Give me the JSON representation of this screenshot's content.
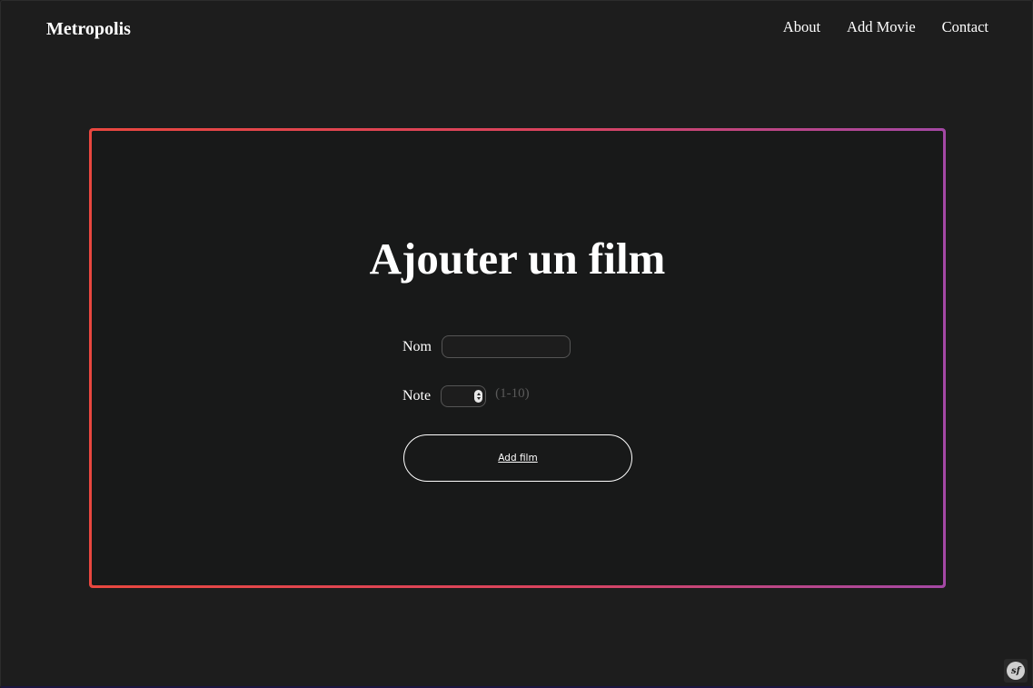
{
  "navbar": {
    "brand": "Metropolis",
    "links": [
      {
        "label": "About"
      },
      {
        "label": "Add Movie"
      },
      {
        "label": "Contact"
      }
    ]
  },
  "form": {
    "title": "Ajouter un film",
    "name_label": "Nom",
    "name_value": "",
    "note_label": "Note",
    "note_value": "",
    "note_hint": "(1-10)",
    "submit_label": "Add film"
  },
  "debug_toolbar": {
    "icon": "symfony-icon",
    "label": "sf"
  },
  "colors": {
    "background": "#1d1d1d",
    "card_background": "#181919",
    "gradient_start": "#e9473f",
    "gradient_end": "#a448a5"
  }
}
